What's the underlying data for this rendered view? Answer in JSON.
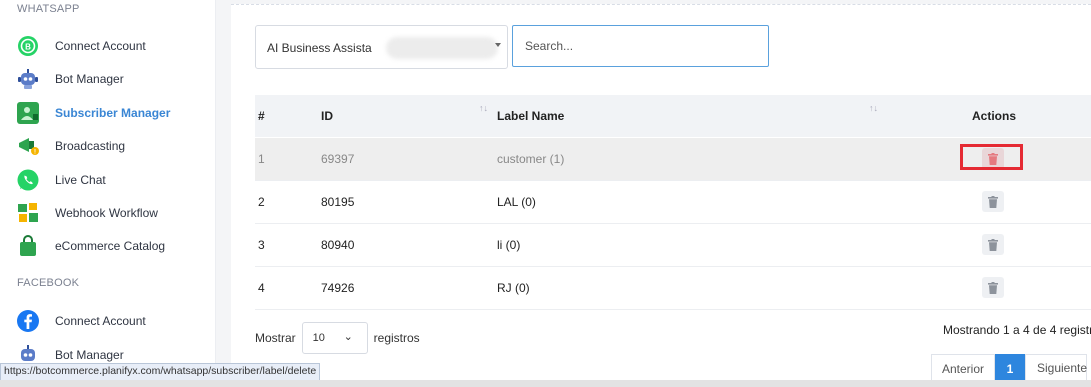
{
  "sidebar": {
    "sections": [
      {
        "title": "WHATSAPP",
        "items": [
          {
            "label": "Connect Account",
            "icon": "whatsapp-business-icon",
            "active": false
          },
          {
            "label": "Bot Manager",
            "icon": "robot-icon",
            "active": false
          },
          {
            "label": "Subscriber Manager",
            "icon": "subscriber-icon",
            "active": true
          },
          {
            "label": "Broadcasting",
            "icon": "megaphone-icon",
            "active": false
          },
          {
            "label": "Live Chat",
            "icon": "whatsapp-icon",
            "active": false
          },
          {
            "label": "Webhook Workflow",
            "icon": "webhook-icon",
            "active": false
          },
          {
            "label": "eCommerce Catalog",
            "icon": "shopping-bag-icon",
            "active": false
          }
        ]
      },
      {
        "title": "FACEBOOK",
        "items": [
          {
            "label": "Connect Account",
            "icon": "facebook-icon",
            "active": false
          },
          {
            "label": "Bot Manager",
            "icon": "robot-icon",
            "active": false
          }
        ]
      }
    ]
  },
  "filters": {
    "account_select": "AI Business Assista",
    "search_placeholder": "Search..."
  },
  "table": {
    "headers": {
      "num": "#",
      "id": "ID",
      "label": "Label Name",
      "actions": "Actions"
    },
    "rows": [
      {
        "num": "1",
        "id": "69397",
        "label": "customer (1)"
      },
      {
        "num": "2",
        "id": "80195",
        "label": "LAL (0)"
      },
      {
        "num": "3",
        "id": "80940",
        "label": "li (0)"
      },
      {
        "num": "4",
        "id": "74926",
        "label": "RJ (0)"
      }
    ]
  },
  "footer": {
    "show_prefix": "Mostrar",
    "page_length": "10",
    "show_suffix": "registros",
    "info": "Mostrando 1 a 4 de 4 registr",
    "prev": "Anterior",
    "current_page": "1",
    "next": "Siguiente"
  },
  "status_url": "https://botcommerce.planifyx.com/whatsapp/subscriber/label/delete",
  "colors": {
    "accent": "#2e86de",
    "active_nav": "#3a86d4",
    "highlight_box": "#e52a33",
    "whatsapp_green": "#25d366",
    "facebook_blue": "#1877f2"
  }
}
